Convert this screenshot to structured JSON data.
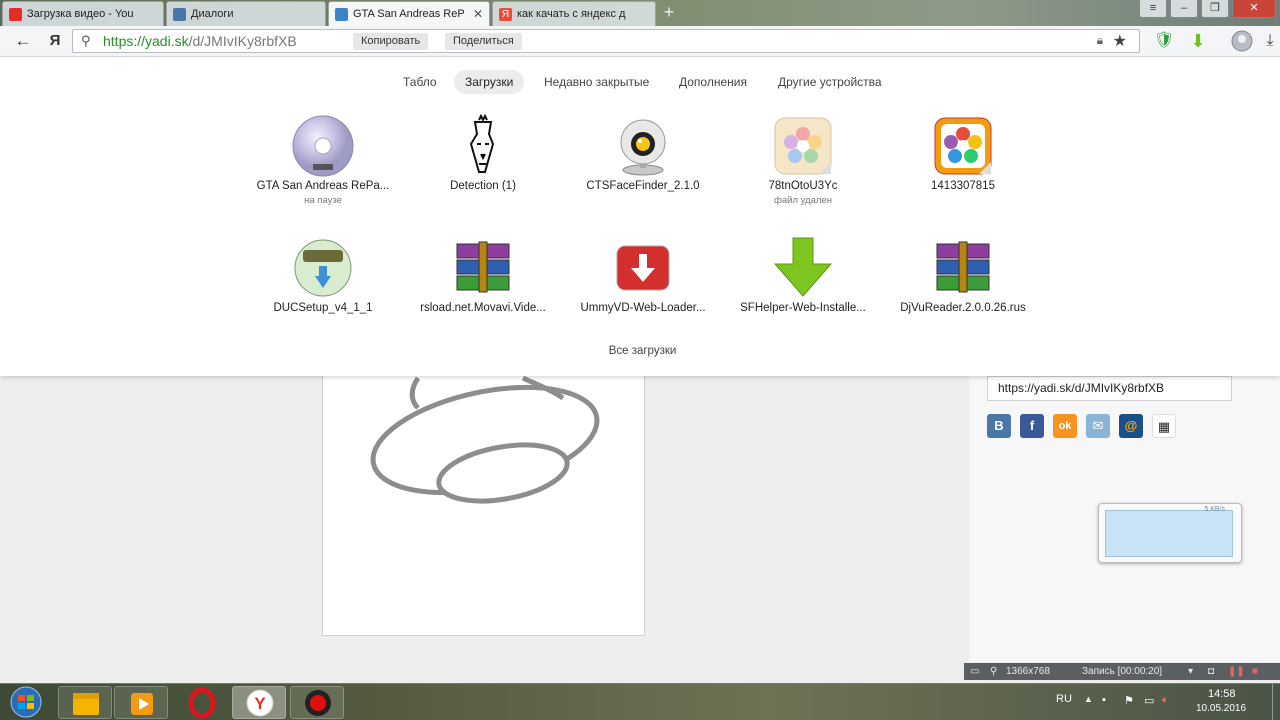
{
  "tabs": [
    {
      "label": "Загрузка видео - You",
      "icon": "youtube-icon",
      "color": "#e52d27"
    },
    {
      "label": "Диалоги",
      "icon": "vk-icon",
      "color": "#4a76a8"
    },
    {
      "label": "GTA San Andreas ReP",
      "icon": "yadisk-icon",
      "color": "#3d84c6",
      "active": true
    },
    {
      "label": "как качать с яндекс д",
      "icon": "yandex-icon",
      "color": "#e94b3c"
    }
  ],
  "address": {
    "url_green": "https://yadi.sk",
    "url_rest": "/d/JMIvIKy8rbfXB",
    "copy_label": "Копировать",
    "share_label": "Поделиться"
  },
  "nav_tabs": [
    {
      "label": "Табло"
    },
    {
      "label": "Загрузки",
      "active": true
    },
    {
      "label": "Недавно закрытые"
    },
    {
      "label": "Дополнения"
    },
    {
      "label": "Другие устройства"
    }
  ],
  "downloads_row1": [
    {
      "name": "GTA San Andreas RePa...",
      "status": "на паузе",
      "icon": "disc-image-icon"
    },
    {
      "name": "Detection (1)",
      "status": "",
      "icon": "tribal-face-icon"
    },
    {
      "name": "CTSFaceFinder_2.1.0",
      "status": "",
      "icon": "webcam-icon"
    },
    {
      "name": "78tnOtoU3Yc",
      "status": "файл удален",
      "icon": "flower-app-icon"
    },
    {
      "name": "1413307815",
      "status": "",
      "icon": "flower-app-orange-icon"
    }
  ],
  "downloads_row2": [
    {
      "name": "DUCSetup_v4_1_1",
      "status": "",
      "icon": "setup-globe-icon"
    },
    {
      "name": "rsload.net.Movavi.Vide...",
      "status": "",
      "icon": "winrar-archive-icon"
    },
    {
      "name": "UmmyVD-Web-Loader...",
      "status": "",
      "icon": "red-download-icon"
    },
    {
      "name": "SFHelper-Web-Installe...",
      "status": "",
      "icon": "green-arrow-icon"
    },
    {
      "name": "DjVuReader.2.0.0.26.rus",
      "status": "",
      "icon": "winrar-archive-icon"
    }
  ],
  "all_downloads_label": "Все загрузки",
  "page": {
    "share_link": "https://yadi.sk/d/JMIvIKy8rbfXB",
    "share_buttons": [
      {
        "label": "B",
        "icon": "vk-share-icon",
        "color": "#4a76a8"
      },
      {
        "label": "f",
        "icon": "facebook-share-icon",
        "color": "#3b5998"
      },
      {
        "label": "ok",
        "icon": "odnoklassniki-share-icon",
        "color": "#f7931e"
      },
      {
        "label": "✉",
        "icon": "mail-share-icon",
        "color": "#8ab3d6"
      },
      {
        "label": "@",
        "icon": "mailru-share-icon",
        "color": "#1a4f8a"
      },
      {
        "label": "▦",
        "icon": "qr-code-icon",
        "color": "#ffffff"
      }
    ],
    "widget_speed": "5 KB/s"
  },
  "recorder": {
    "resolution": "1366x768",
    "status": "Запись [00:00:20]"
  },
  "tray": {
    "lang": "RU",
    "time": "14:58",
    "date": "10.05.2016"
  }
}
